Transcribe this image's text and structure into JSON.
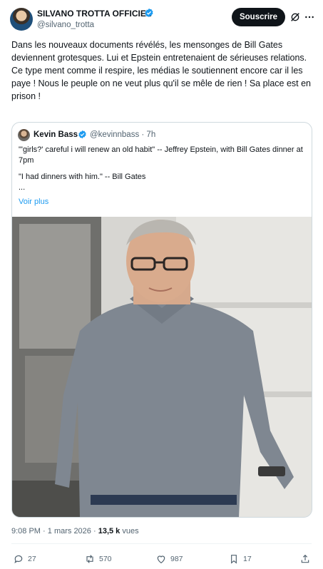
{
  "post": {
    "author_name": "SILVANO TROTTA OFFICIEL",
    "author_handle": "@silvano_trotta",
    "follow_label": "Souscrire",
    "text_p1": "Dans les nouveaux documents révélés, les mensonges de Bill Gates deviennent grotesques. Lui et Epstein entretenaient de sérieuses relations.",
    "text_p2": "Ce type ment comme il respire, les médias le soutiennent encore car il les paye ! Nous le peuple on ne veut plus qu'il se mêle de rien ! Sa place est en prison !",
    "time": "9:08 PM",
    "date": "1 mars 2026",
    "views_count": "13,5 k",
    "views_label": "vues"
  },
  "quote": {
    "author_name": "Kevin Bass",
    "author_handle": "@kevinnbass · 7h",
    "line1": "\"'girls?' careful i will renew an old habit\" -- Jeffrey Epstein, with Bill Gates dinner at 7pm",
    "line2": "\"I had dinners with him.\" -- Bill Gates\n...",
    "more_label": "Voir plus"
  },
  "actions": {
    "replies": "27",
    "reposts": "570",
    "likes": "987",
    "bookmarks": "17"
  },
  "colors": {
    "accent": "#1d9bf0",
    "text": "#0f1419",
    "muted": "#536471",
    "border": "#cfd9de"
  },
  "icons": [
    "verified-badge-icon",
    "grok-icon",
    "more-icon",
    "reply-icon",
    "repost-icon",
    "like-icon",
    "bookmark-icon",
    "share-icon"
  ]
}
